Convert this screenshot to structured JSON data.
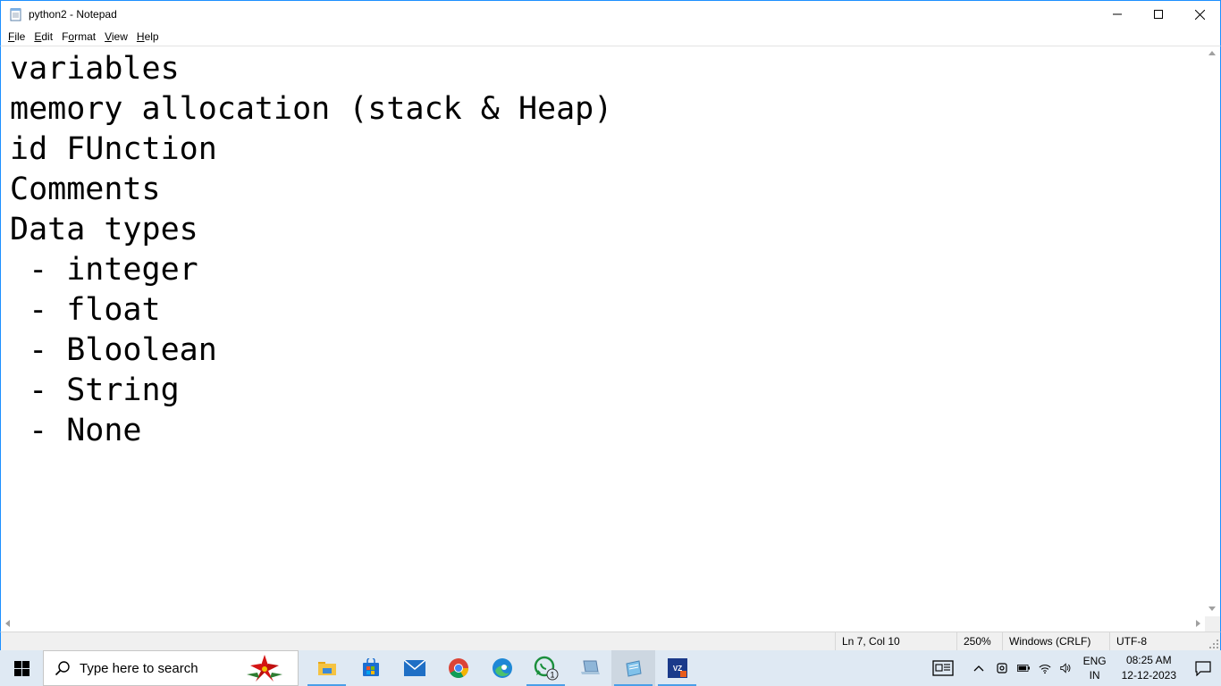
{
  "window": {
    "title": "python2 - Notepad"
  },
  "menu": [
    {
      "label": "File",
      "hotkey": "F",
      "rest": "ile"
    },
    {
      "label": "Edit",
      "hotkey": "E",
      "rest": "dit"
    },
    {
      "label": "Format",
      "hotkey": "o",
      "prefix": "F",
      "rest": "rmat"
    },
    {
      "label": "View",
      "hotkey": "V",
      "rest": "iew"
    },
    {
      "label": "Help",
      "hotkey": "H",
      "rest": "elp"
    }
  ],
  "editor": {
    "lines": [
      "variables",
      "memory allocation (stack & Heap)",
      "id FUnction",
      "Comments",
      "Data types",
      " - integer",
      " - float",
      " - Bloolean",
      " - String",
      " - None"
    ]
  },
  "status": {
    "position": "Ln 7, Col 10",
    "zoom": "250%",
    "line_ending": "Windows (CRLF)",
    "encoding": "UTF-8"
  },
  "taskbar": {
    "search_placeholder": "Type here to search",
    "whatsapp_badge": "1",
    "tablet_label": "VZ",
    "lang_primary": "ENG",
    "lang_secondary": "IN",
    "time": "08:25 AM",
    "date": "12-12-2023"
  },
  "colors": {
    "window_border": "#1e90ff",
    "taskbar_bg": "#dfe9f3",
    "statusbar_bg": "#f0f0f0"
  }
}
